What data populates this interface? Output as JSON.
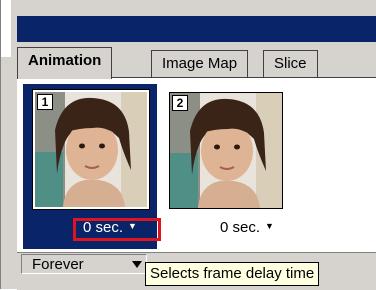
{
  "tabs": [
    {
      "label": "Animation",
      "active": true
    },
    {
      "label": "Image Map",
      "active": false
    },
    {
      "label": "Slice",
      "active": false
    }
  ],
  "frames": [
    {
      "number": "1",
      "delay": "0 sec.",
      "selected": true
    },
    {
      "number": "2",
      "delay": "0 sec.",
      "selected": false
    }
  ],
  "loop": {
    "value": "Forever"
  },
  "tooltip": {
    "text": "Selects frame delay time"
  },
  "colors": {
    "selection": "#0a246a",
    "highlight": "#e0141e",
    "panel": "#d6d3ce",
    "tooltip_bg": "#ffffe1"
  }
}
